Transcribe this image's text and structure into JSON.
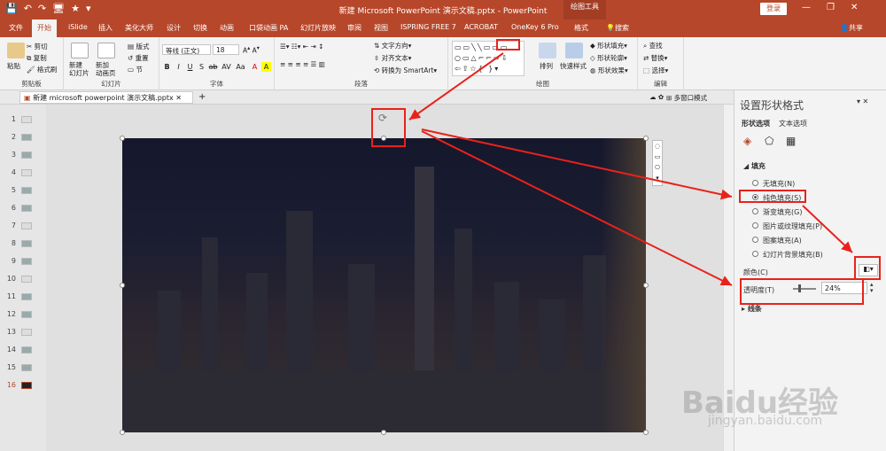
{
  "titlebar": {
    "title": "新建 Microsoft PowerPoint 演示文稿.pptx  -  PowerPoint",
    "context": "绘图工具",
    "login": "登录",
    "min": "—",
    "restore": "❐",
    "close": "✕",
    "qat": [
      "💾",
      "↶",
      "↷",
      "🖥",
      "★",
      "▾"
    ]
  },
  "tabs": [
    "文件",
    "开始",
    "iSlide",
    "插入",
    "美化大师",
    "设计",
    "切换",
    "动画",
    "口袋动画 PA",
    "幻灯片放映",
    "审阅",
    "视图",
    "ISPRING FREE 7",
    "ACROBAT",
    "OneKey 6 Pro",
    "格式"
  ],
  "search": "搜索",
  "share": "共享",
  "ribbon": {
    "clipboard": {
      "label": "剪贴板",
      "paste": "粘贴",
      "cut": "剪切",
      "copy": "复制",
      "format_painter": "格式刷"
    },
    "slides": {
      "label": "幻灯片",
      "new_slide": "新建\n幻灯片",
      "new_anim": "新加\n动画页",
      "layout": "版式",
      "reset": "重置",
      "section": "节"
    },
    "font": {
      "label": "字体",
      "name": "等线 (正文)",
      "size": "18",
      "buttons": [
        "B",
        "I",
        "U",
        "S",
        "ab",
        "AV",
        "Aa",
        "A",
        "A"
      ]
    },
    "paragraph": {
      "label": "段落",
      "text_dir": "文字方向",
      "align_text": "对齐文本",
      "smartart": "转换为 SmartArt"
    },
    "drawing": {
      "label": "绘图",
      "arrange": "排列",
      "quick_styles": "快速样式",
      "fill": "形状填充",
      "outline": "形状轮廓",
      "effect": "形状效果"
    },
    "editing": {
      "label": "编辑",
      "find": "查找",
      "replace": "替换",
      "select": "选择"
    }
  },
  "doc": {
    "tab": "新建 microsoft powerpoint 演示文稿.pptx",
    "multi": "多窗口模式"
  },
  "slides": [
    "1",
    "2",
    "3",
    "4",
    "5",
    "6",
    "7",
    "8",
    "9",
    "10",
    "11",
    "12",
    "13",
    "14",
    "15",
    "16"
  ],
  "pane": {
    "title": "设置形状格式",
    "tab_shape": "形状选项",
    "tab_text": "文本选项",
    "fill_header": "填充",
    "options": [
      "无填充(N)",
      "纯色填充(S)",
      "渐变填充(G)",
      "图片或纹理填充(P)",
      "图案填充(A)",
      "幻灯片背景填充(B)"
    ],
    "selected": 1,
    "color_label": "颜色(C)",
    "transparency_label": "透明度(T)",
    "transparency": "24%",
    "line_header": "线条"
  },
  "watermark": {
    "brand": "Baidu经验",
    "url": "jingyan.baidu.com"
  },
  "colors": {
    "accent": "#b7472a",
    "annot": "#e8221b"
  }
}
